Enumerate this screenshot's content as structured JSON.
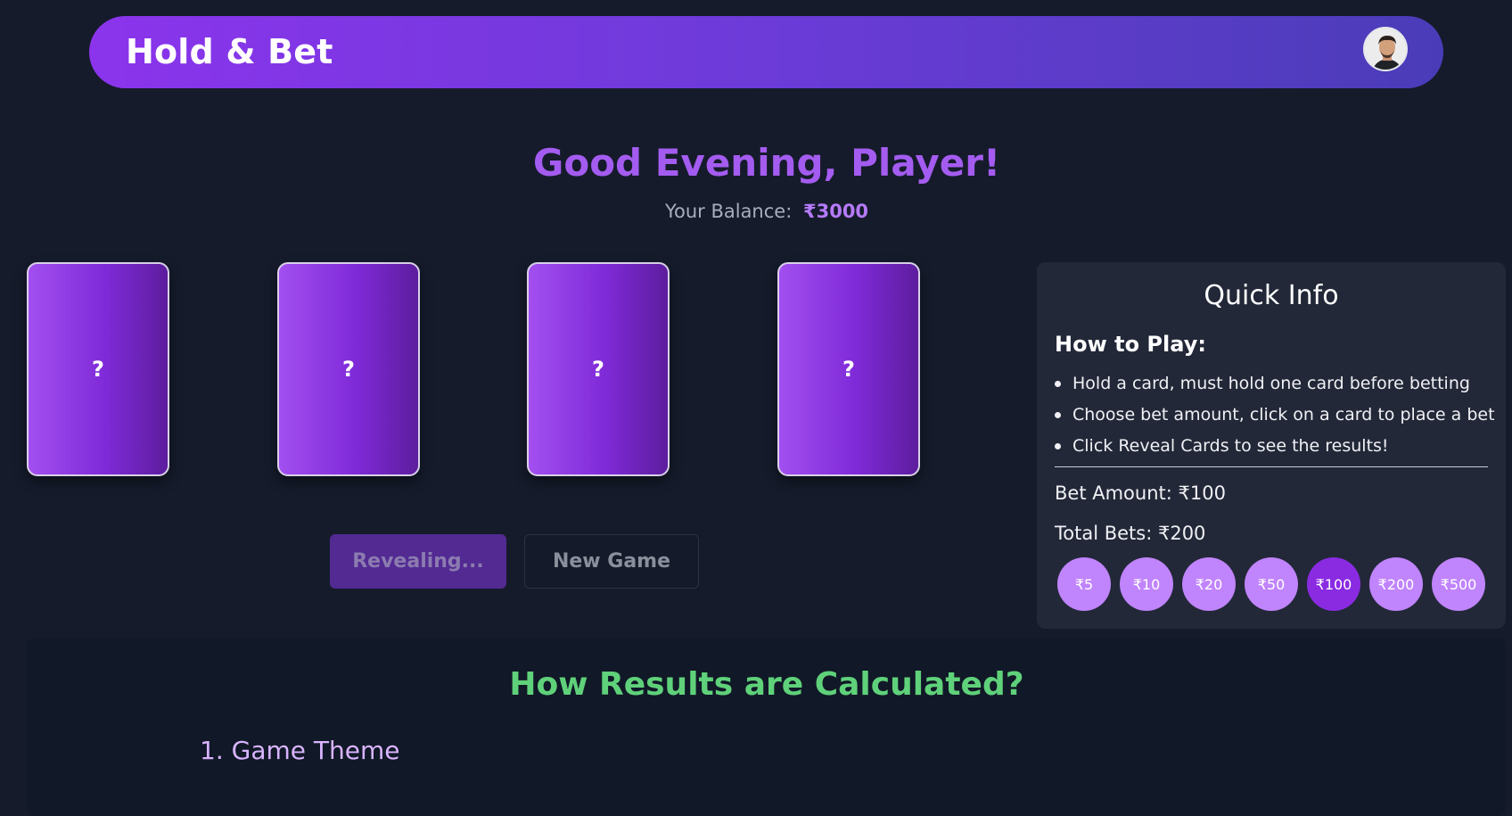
{
  "header": {
    "brand": "Hold & Bet",
    "avatar_icon": "user-avatar"
  },
  "greeting": "Good Evening, Player!",
  "balance": {
    "label": "Your Balance:",
    "value": "₹3000"
  },
  "cards": [
    {
      "face": "?"
    },
    {
      "face": "?"
    },
    {
      "face": "?"
    },
    {
      "face": "?"
    }
  ],
  "actions": {
    "reveal_label": "Revealing...",
    "new_game_label": "New Game"
  },
  "quick_info": {
    "title": "Quick Info",
    "how_to_heading": "How to Play:",
    "rules": [
      "Hold a card, must hold one card before betting",
      "Choose bet amount, click on a card to place a bet",
      "Click Reveal Cards to see the results!"
    ],
    "bet_amount": "Bet Amount: ₹100",
    "total_bets": "Total Bets: ₹200",
    "chips": [
      "₹5",
      "₹10",
      "₹20",
      "₹50",
      "₹100",
      "₹200",
      "₹500"
    ],
    "selected_chip": "₹100"
  },
  "results": {
    "title": "How Results are Calculated?",
    "first_item": "1. Game Theme"
  },
  "colors": {
    "background": "#151b2b",
    "accent_purple": "#8a2be2",
    "chip": "#c084fc",
    "results_title": "#5fd17a"
  }
}
